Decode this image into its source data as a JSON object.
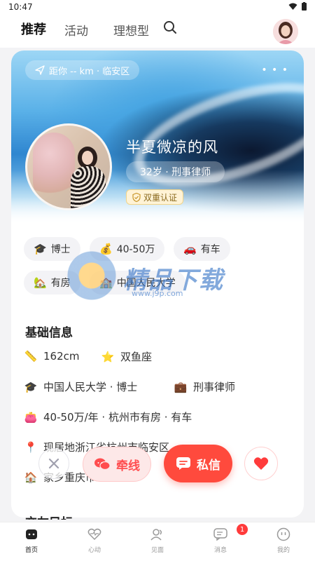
{
  "status_bar": {
    "time": "10:47"
  },
  "top_nav": {
    "tabs": [
      {
        "label": "推荐",
        "active": true
      },
      {
        "label": "活动",
        "active": false
      },
      {
        "label": "理想型",
        "active": false
      }
    ],
    "accent_color": "#ff4d6d"
  },
  "profile": {
    "distance_text": "距你 -- km · 临安区",
    "more": "• • •",
    "name": "半夏微凉的风",
    "age_job": "32岁 · 刑事律师",
    "verify_badge": "双重认证"
  },
  "tags": [
    {
      "icon": "graduation-cap-icon",
      "label": "博士"
    },
    {
      "icon": "money-bag-icon",
      "label": "40-50万"
    },
    {
      "icon": "car-icon",
      "label": "有车"
    },
    {
      "icon": "house-icon",
      "label": "有房"
    },
    {
      "icon": "school-building-icon",
      "label": "中国人民大学"
    }
  ],
  "basic_info": {
    "title": "基础信息",
    "height": "162cm",
    "zodiac": "双鱼座",
    "education": "中国人民大学 · 博士",
    "job": "刑事律师",
    "income_assets": "40-50万/年 · 杭州市有房 · 有车",
    "residence": "现居地浙江省杭州市临安区",
    "hometown": "家乡重庆市"
  },
  "actions": {
    "qianxian": "牵线",
    "sixin": "私信",
    "primary_color": "#ff4a3d"
  },
  "next_section_title": "交友目标",
  "watermark": {
    "text": "精品下载",
    "url": "www.j9p.com"
  },
  "bottom_nav": [
    {
      "label": "首页",
      "active": true
    },
    {
      "label": "心动",
      "active": false
    },
    {
      "label": "见面",
      "active": false
    },
    {
      "label": "消息",
      "active": false,
      "badge": "1"
    },
    {
      "label": "我的",
      "active": false
    }
  ]
}
